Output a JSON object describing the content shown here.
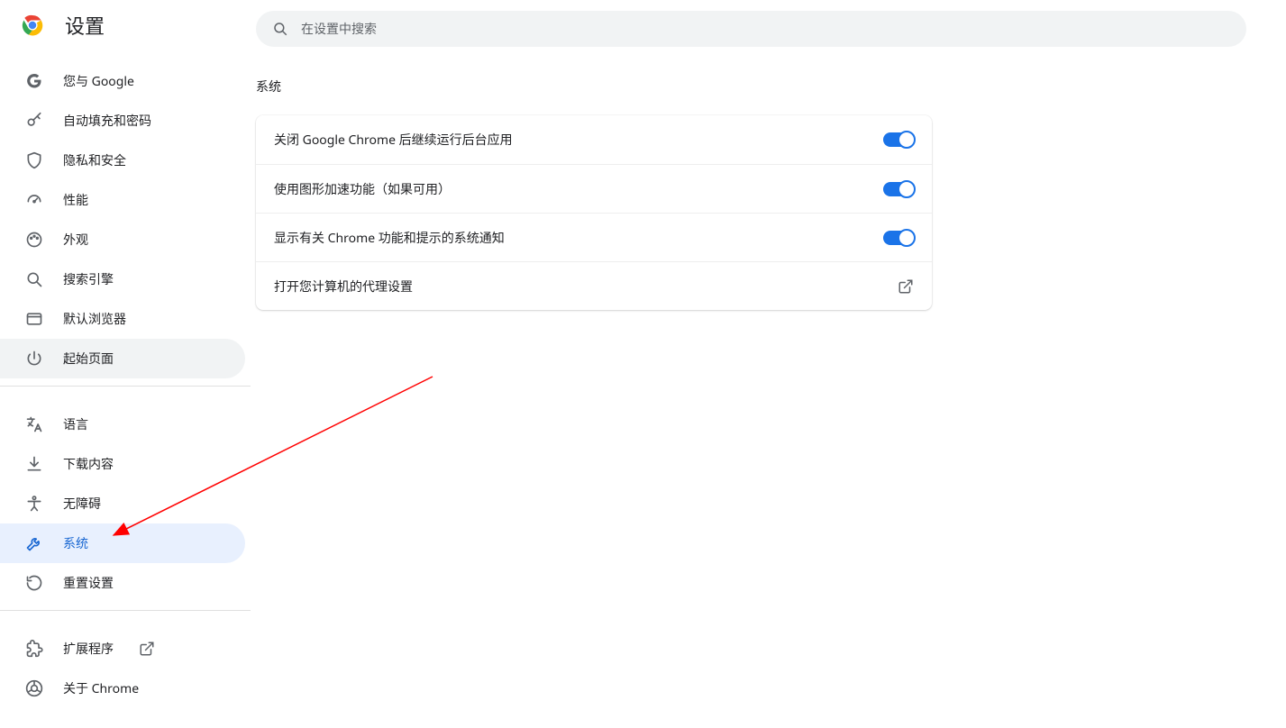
{
  "app_title": "设置",
  "search_placeholder": "在设置中搜索",
  "nav": {
    "group1": [
      {
        "icon": "google",
        "label": "您与 Google"
      },
      {
        "icon": "key",
        "label": "自动填充和密码"
      },
      {
        "icon": "shield",
        "label": "隐私和安全"
      },
      {
        "icon": "speed",
        "label": "性能"
      },
      {
        "icon": "palette",
        "label": "外观"
      },
      {
        "icon": "search",
        "label": "搜索引擎"
      },
      {
        "icon": "browser",
        "label": "默认浏览器"
      },
      {
        "icon": "power",
        "label": "起始页面",
        "hovered": true
      }
    ],
    "group2": [
      {
        "icon": "translate",
        "label": "语言"
      },
      {
        "icon": "download",
        "label": "下载内容"
      },
      {
        "icon": "accessibility",
        "label": "无障碍"
      },
      {
        "icon": "wrench",
        "label": "系统",
        "selected": true
      },
      {
        "icon": "reset",
        "label": "重置设置"
      }
    ],
    "group3": [
      {
        "icon": "extension",
        "label": "扩展程序",
        "external": true
      },
      {
        "icon": "chrome",
        "label": "关于 Chrome"
      }
    ]
  },
  "section_title": "系统",
  "rows": [
    {
      "label": "关闭 Google Chrome 后继续运行后台应用",
      "type": "toggle",
      "on": true
    },
    {
      "label": "使用图形加速功能（如果可用）",
      "type": "toggle",
      "on": true
    },
    {
      "label": "显示有关 Chrome 功能和提示的系统通知",
      "type": "toggle",
      "on": true
    },
    {
      "label": "打开您计算机的代理设置",
      "type": "link"
    }
  ]
}
